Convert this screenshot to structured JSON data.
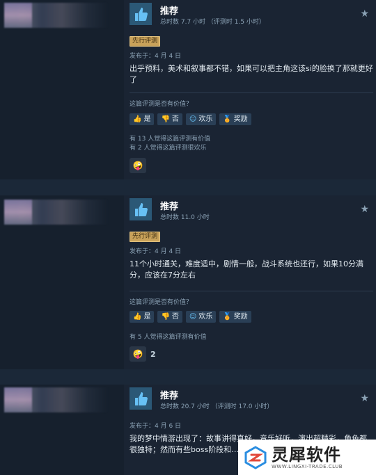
{
  "reviews": [
    {
      "verdict": "推荐",
      "hours": "总时数 7.7 小时  （评测时 1.5 小时）",
      "badge": "先行评测",
      "posted": "发布于：4 月 4 日",
      "text": "出乎预料，美术和叙事都不错，如果可以把主角这该si的脸换了那就更好了",
      "helpful_question": "这篇评测是否有价值？",
      "votes": {
        "yes": "是",
        "no": "否",
        "funny": "欢乐",
        "award": "奖励"
      },
      "counts": [
        "有 13 人觉得这篇评测有价值",
        "有 2 人觉得这篇评测很欢乐"
      ],
      "award_count": ""
    },
    {
      "verdict": "推荐",
      "hours": "总时数 11.0 小时",
      "badge": "先行评测",
      "posted": "发布于：4 月 4 日",
      "text": "11个小时通关，难度适中，剧情一般，战斗系统也还行，如果10分满分，应该在7分左右",
      "helpful_question": "这篇评测是否有价值？",
      "votes": {
        "yes": "是",
        "no": "否",
        "funny": "欢乐",
        "award": "奖励"
      },
      "counts": [
        "有 5 人觉得这篇评测有价值"
      ],
      "award_count": "2"
    },
    {
      "verdict": "推荐",
      "hours": "总时数 20.7 小时  （评测时 17.0 小时）",
      "posted": "发布于：4 月 6 日",
      "text": "我的梦中情游出现了：故事讲得真好，音乐好听，演出超精彩，角色都很独特；然而有些boss阶段和……优点面前不值一提"
    }
  ],
  "watermark": {
    "title": "灵犀软件",
    "subtitle": "WWW.LINGXI-TRADE.CLUB"
  }
}
